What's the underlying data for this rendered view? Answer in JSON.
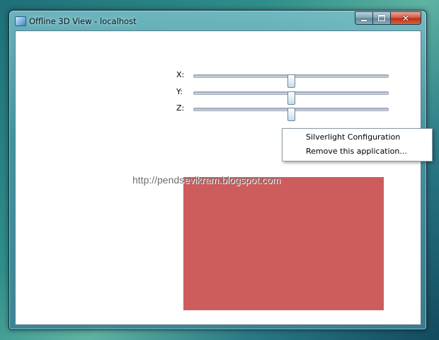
{
  "window": {
    "title": "Offline 3D View - localhost",
    "icon": "silverlight-app-icon",
    "caption_buttons": [
      "minimize-icon",
      "maximize-icon",
      "close-icon"
    ]
  },
  "sliders": [
    {
      "label": "X:",
      "value": 0.5
    },
    {
      "label": "Y:",
      "value": 0.5
    },
    {
      "label": "Z:",
      "value": 0.5
    }
  ],
  "context_menu": {
    "items": [
      "Silverlight Configuration",
      "Remove this application..."
    ]
  },
  "watermark": "http://pendsevikram.blogspot.com",
  "plane": {
    "color": "#cd5c5c"
  }
}
